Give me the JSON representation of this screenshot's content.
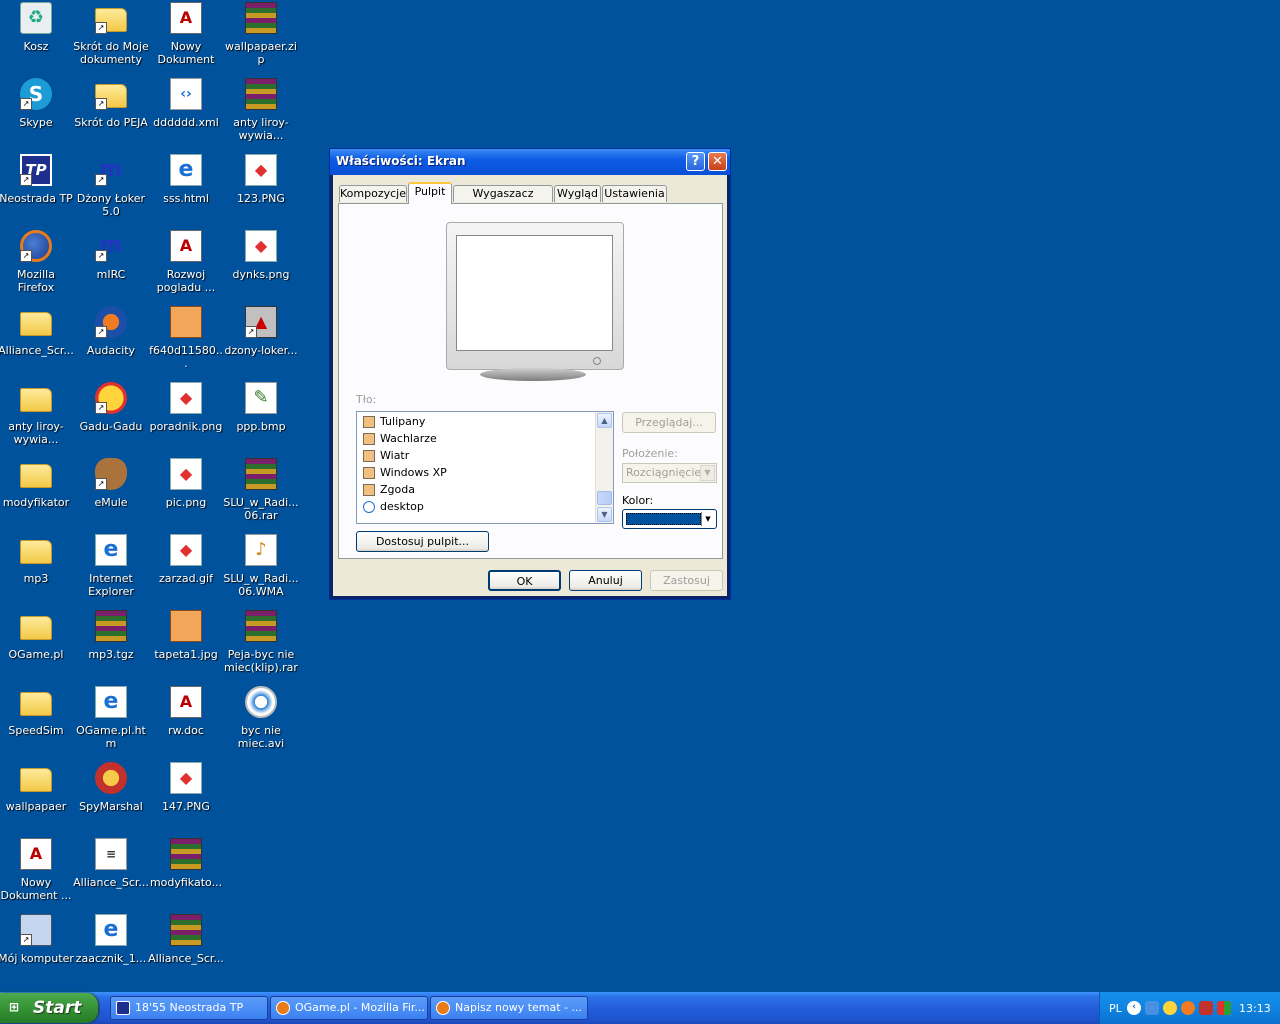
{
  "desktop": {
    "icons": [
      {
        "label": "Kosz",
        "type": "bin",
        "glyph": "♻",
        "shortcut": false
      },
      {
        "label": "Skype",
        "type": "skype",
        "glyph": "S",
        "shortcut": true
      },
      {
        "label": "Neostrada TP",
        "type": "tp",
        "glyph": "TP",
        "shortcut": true
      },
      {
        "label": "Mozilla Firefox",
        "type": "ff",
        "glyph": "",
        "shortcut": true
      },
      {
        "label": "Alliance_Scr...",
        "type": "folder",
        "glyph": "",
        "shortcut": false
      },
      {
        "label": "anty liroy-wywia...",
        "type": "folder",
        "glyph": "",
        "shortcut": false
      },
      {
        "label": "modyfikator",
        "type": "folder",
        "glyph": "",
        "shortcut": false
      },
      {
        "label": "mp3",
        "type": "folder",
        "glyph": "",
        "shortcut": false
      },
      {
        "label": "OGame.pl",
        "type": "folder",
        "glyph": "",
        "shortcut": false
      },
      {
        "label": "SpeedSim",
        "type": "folder",
        "glyph": "",
        "shortcut": false
      },
      {
        "label": "wallpapaer",
        "type": "folder",
        "glyph": "",
        "shortcut": false
      },
      {
        "label": "Nowy Dokument ...",
        "type": "doc",
        "glyph": "A",
        "shortcut": false
      },
      {
        "label": "Mój komputer",
        "type": "pc",
        "glyph": "",
        "shortcut": true
      },
      {
        "label": "Skrót do Moje dokumenty",
        "type": "folder",
        "glyph": "",
        "shortcut": true
      },
      {
        "label": "Skrót do PEJA",
        "type": "folder",
        "glyph": "",
        "shortcut": true
      },
      {
        "label": "Dżony Łoker 5.0",
        "type": "mirc",
        "glyph": "m",
        "shortcut": true
      },
      {
        "label": "mIRC",
        "type": "mirc",
        "glyph": "m",
        "shortcut": true
      },
      {
        "label": "Audacity",
        "type": "aud",
        "glyph": "",
        "shortcut": true
      },
      {
        "label": "Gadu-Gadu",
        "type": "gg",
        "glyph": "",
        "shortcut": true
      },
      {
        "label": "eMule",
        "type": "mule",
        "glyph": "",
        "shortcut": true
      },
      {
        "label": "Internet Explorer",
        "type": "ie",
        "glyph": "e",
        "shortcut": false
      },
      {
        "label": "mp3.tgz",
        "type": "rar",
        "glyph": "",
        "shortcut": false
      },
      {
        "label": "OGame.pl.htm",
        "type": "ie",
        "glyph": "e",
        "shortcut": false
      },
      {
        "label": "SpyMarshal",
        "type": "spy",
        "glyph": "",
        "shortcut": false
      },
      {
        "label": "Alliance_Scr...",
        "type": "tmp",
        "glyph": "≡",
        "shortcut": false
      },
      {
        "label": "zaacznik_1...",
        "type": "ie",
        "glyph": "e",
        "shortcut": false
      },
      {
        "label": "Nowy Dokument s...",
        "type": "doc",
        "glyph": "A",
        "shortcut": false
      },
      {
        "label": "dddddd.xml",
        "type": "xml",
        "glyph": "‹›",
        "shortcut": false
      },
      {
        "label": "sss.html",
        "type": "ie",
        "glyph": "e",
        "shortcut": false
      },
      {
        "label": "Rozwoj pogladu ...",
        "type": "doc",
        "glyph": "A",
        "shortcut": false
      },
      {
        "label": "f640d11580...",
        "type": "jpg",
        "glyph": "",
        "shortcut": false
      },
      {
        "label": "poradnik.png",
        "type": "png",
        "glyph": "◆",
        "shortcut": false
      },
      {
        "label": "pic.png",
        "type": "png",
        "glyph": "◆",
        "shortcut": false
      },
      {
        "label": "zarzad.gif",
        "type": "png",
        "glyph": "◆",
        "shortcut": false
      },
      {
        "label": "tapeta1.jpg",
        "type": "jpg",
        "glyph": "",
        "shortcut": false
      },
      {
        "label": "rw.doc",
        "type": "doc",
        "glyph": "A",
        "shortcut": false
      },
      {
        "label": "147.PNG",
        "type": "png",
        "glyph": "◆",
        "shortcut": false
      },
      {
        "label": "modyfikato...",
        "type": "rar",
        "glyph": "",
        "shortcut": false
      },
      {
        "label": "Alliance_Scr...",
        "type": "rar",
        "glyph": "",
        "shortcut": false
      },
      {
        "label": "wallpapaer.zip",
        "type": "rar",
        "glyph": "",
        "shortcut": false
      },
      {
        "label": "anty liroy-wywia...",
        "type": "rar",
        "glyph": "",
        "shortcut": false
      },
      {
        "label": "123.PNG",
        "type": "png",
        "glyph": "◆",
        "shortcut": false
      },
      {
        "label": "dynks.png",
        "type": "png",
        "glyph": "◆",
        "shortcut": false
      },
      {
        "label": "dzony-loker...",
        "type": "loker",
        "glyph": "▲",
        "shortcut": true
      },
      {
        "label": "ppp.bmp",
        "type": "bmp",
        "glyph": "✎",
        "shortcut": false
      },
      {
        "label": "SLU_w_Radi... 06.rar",
        "type": "rar",
        "glyph": "",
        "shortcut": false
      },
      {
        "label": "SLU_w_Radi... 06.WMA",
        "type": "wma",
        "glyph": "♪",
        "shortcut": false
      },
      {
        "label": "Peja-byc nie miec(klip).rar",
        "type": "rar",
        "glyph": "",
        "shortcut": false
      },
      {
        "label": "byc nie miec.avi",
        "type": "avi",
        "glyph": "",
        "shortcut": false
      }
    ]
  },
  "dialog": {
    "title": "Właściwości: Ekran",
    "help_glyph": "?",
    "close_glyph": "✕",
    "tabs": [
      "Kompozycje",
      "Pulpit",
      "Wygaszacz ekranu",
      "Wygląd",
      "Ustawienia"
    ],
    "active_tab": "Pulpit",
    "background_label": "Tło:",
    "background_items": [
      "Tulipany",
      "Wachlarze",
      "Wiatr",
      "Windows XP",
      "Zgoda",
      "desktop"
    ],
    "browse_button": "Przeglądaj...",
    "position_label": "Położenie:",
    "position_value": "Rozciągnięcie",
    "color_label": "Kolor:",
    "selected_color": "#00529C",
    "customize_button": "Dostosuj pulpit...",
    "ok_button": "OK",
    "cancel_button": "Anuluj",
    "apply_button": "Zastosuj"
  },
  "taskbar": {
    "start_label": "Start",
    "start_logo": "⊞",
    "tasks": [
      "18'55 Neostrada TP",
      "OGame.pl - Mozilla Fir...",
      "Napisz nowy temat - ..."
    ],
    "language": "PL",
    "expand_glyph": "‹",
    "clock": "13:13"
  },
  "colors": {
    "desktop_bg": "#00529C",
    "taskbar_blue": "#245EDB",
    "start_green": "#3E9C3E"
  }
}
